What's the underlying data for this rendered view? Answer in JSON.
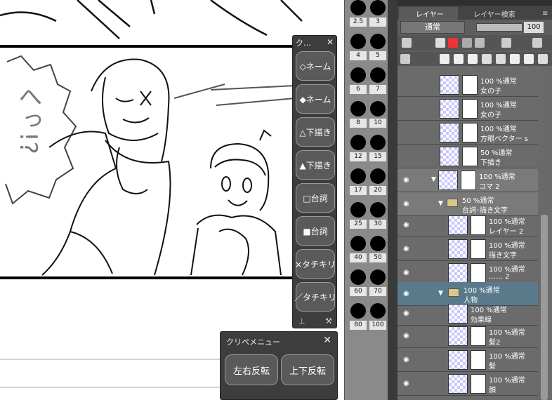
{
  "quick_access": {
    "title": "ク…",
    "close": "✕",
    "buttons": [
      "◇ネーム",
      "◆ネーム",
      "△下描き",
      "▲下描き",
      "□台詞",
      "■台詞",
      "×タチキリ",
      "／タチキリ"
    ]
  },
  "clip_menu": {
    "title": "クリペメニュー",
    "close": "✕",
    "buttons": [
      "左右反転",
      "上下反転"
    ]
  },
  "canvas": {
    "speech_text": "へっ!?"
  },
  "brush_sizes": [
    "2.5",
    "3",
    "4",
    "5",
    "6",
    "7",
    "8",
    "10",
    "12",
    "15",
    "17",
    "20",
    "25",
    "30",
    "40",
    "50",
    "60",
    "70",
    "80",
    "100"
  ],
  "layer_panel": {
    "tab_layer": "レイヤー",
    "tab_search": "レイヤー検索",
    "blend_mode": "通常",
    "opacity": "100",
    "layers": [
      {
        "l1": "100 %通常",
        "l2": "女の子"
      },
      {
        "l1": "100 %通常",
        "l2": "女の子"
      },
      {
        "l1": "100 %通常",
        "l2": "方眼ベクター s"
      },
      {
        "l1": "50 %通常",
        "l2": "下描き"
      },
      {
        "l1": "100 %通常",
        "l2": "コマ 2"
      },
      {
        "l1": "50 %通常",
        "l2": "台詞･描き文字"
      },
      {
        "l1": "100 %通常",
        "l2": "レイヤー 2"
      },
      {
        "l1": "100 %通常",
        "l2": "描き文字"
      },
      {
        "l1": "100 %通常",
        "l2": "…… 2"
      },
      {
        "l1": "100 %通常",
        "l2": "人物"
      },
      {
        "l1": "100 %通常",
        "l2": "効果線"
      },
      {
        "l1": "100 %通常",
        "l2": "髪2"
      },
      {
        "l1": "100 %通常",
        "l2": "髪"
      },
      {
        "l1": "100 %通常",
        "l2": "顔"
      }
    ]
  }
}
